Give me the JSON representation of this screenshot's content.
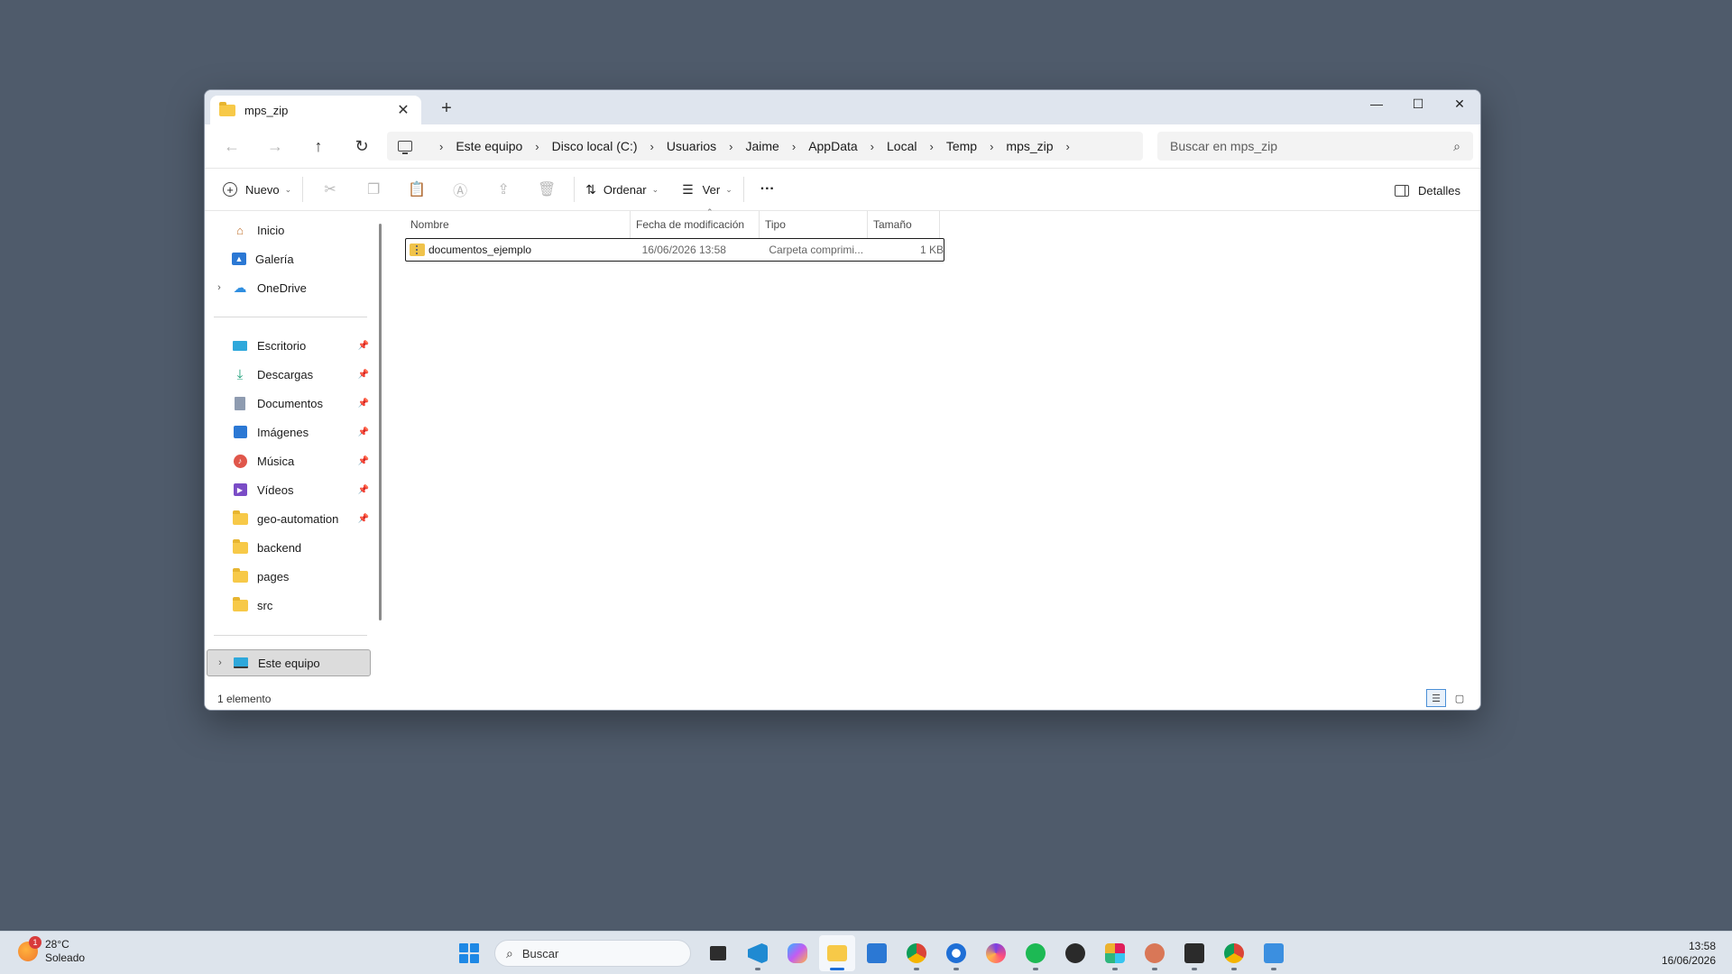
{
  "window": {
    "tab_title": "mps_zip",
    "tab_close": "✕",
    "new_tab": "+",
    "controls": {
      "minimize": "—",
      "maximize": "☐",
      "close": "✕"
    }
  },
  "nav": {
    "back": "←",
    "forward": "→",
    "up": "↑",
    "refresh": "↻"
  },
  "breadcrumb": [
    "Este equipo",
    "Disco local (C:)",
    "Usuarios",
    "Jaime",
    "AppData",
    "Local",
    "Temp",
    "mps_zip"
  ],
  "search": {
    "placeholder": "Buscar en mps_zip"
  },
  "toolbar": {
    "new_label": "Nuevo",
    "sort_label": "Ordenar",
    "view_label": "Ver",
    "more_label": "···",
    "details_label": "Detalles"
  },
  "sidebar": {
    "quick": [
      {
        "label": "Inicio",
        "icon": "home-icon"
      },
      {
        "label": "Galería",
        "icon": "gallery-icon"
      },
      {
        "label": "OneDrive",
        "icon": "onedrive-icon",
        "expandable": true
      }
    ],
    "pinned": [
      {
        "label": "Escritorio",
        "icon": "desktop-icon",
        "pinned": true
      },
      {
        "label": "Descargas",
        "icon": "downloads-icon",
        "pinned": true
      },
      {
        "label": "Documentos",
        "icon": "documents-icon",
        "pinned": true
      },
      {
        "label": "Imágenes",
        "icon": "pictures-icon",
        "pinned": true
      },
      {
        "label": "Música",
        "icon": "music-icon",
        "pinned": true
      },
      {
        "label": "Vídeos",
        "icon": "videos-icon",
        "pinned": true
      },
      {
        "label": "geo-automation",
        "icon": "folder-icon",
        "pinned": true
      },
      {
        "label": "backend",
        "icon": "folder-icon",
        "pinned": false
      },
      {
        "label": "pages",
        "icon": "folder-icon",
        "pinned": false
      },
      {
        "label": "src",
        "icon": "folder-icon",
        "pinned": false
      }
    ],
    "this_pc": {
      "label": "Este equipo",
      "icon": "this-pc-icon",
      "selected": true
    }
  },
  "columns": [
    "Nombre",
    "Fecha de modificación",
    "Tipo",
    "Tamaño"
  ],
  "files": [
    {
      "name": "documentos_ejemplo",
      "modified": "16/06/2026 13:58",
      "type": "Carpeta comprimi...",
      "size": "1 KB"
    }
  ],
  "status": {
    "count_text": "1 elemento"
  },
  "taskbar": {
    "weather_temp": "28°C",
    "weather_desc": "Soleado",
    "weather_badge": "1",
    "search_placeholder": "Buscar",
    "time": "13:58",
    "date": "16/06/2026"
  },
  "colors": {
    "desktop": "#4f5b6b",
    "accent": "#1d6ed8",
    "folder": "#f7c948"
  }
}
